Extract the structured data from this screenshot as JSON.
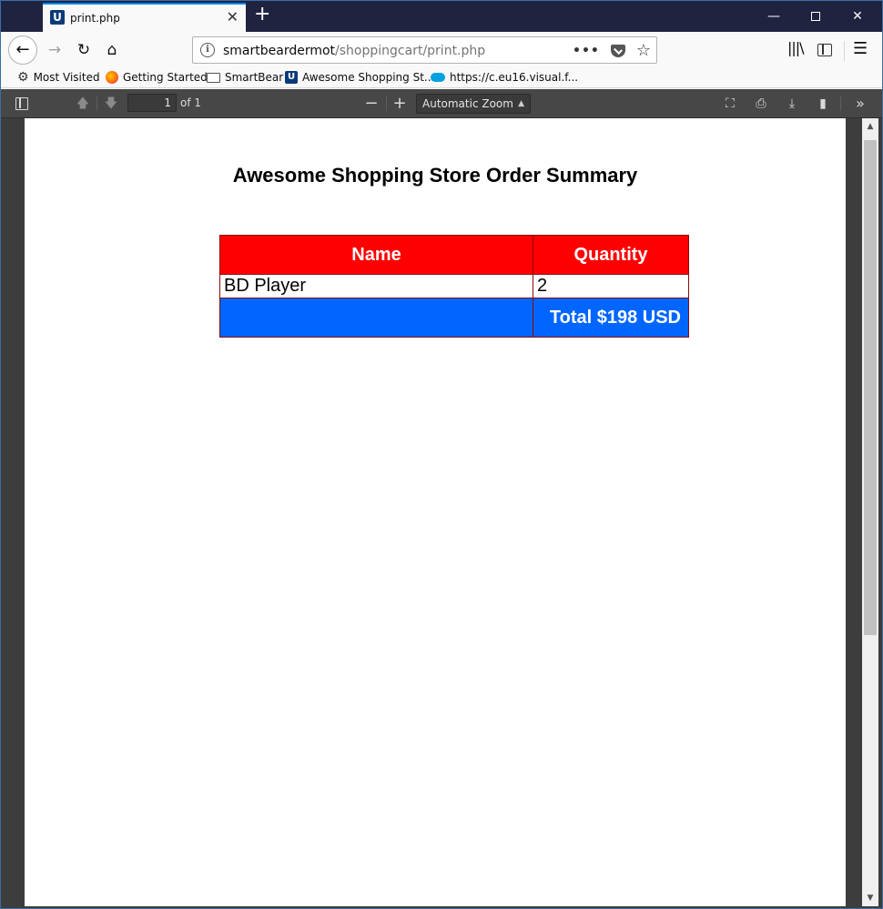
{
  "browser": {
    "tab_title": "print.php",
    "tab_favicon_letter": "U",
    "url_domain": "smartbeardermot",
    "url_path": "/shoppingcart/print.php"
  },
  "bookmarks": [
    {
      "label": "Most Visited",
      "icon": "gear-icon"
    },
    {
      "label": "Getting Started",
      "icon": "firefox-icon"
    },
    {
      "label": "SmartBear",
      "icon": "folder-icon"
    },
    {
      "label": "Awesome Shopping St...",
      "icon": "u-favicon-icon"
    },
    {
      "label": "https://c.eu16.visual.f...",
      "icon": "salesforce-cloud-icon"
    }
  ],
  "pdf_toolbar": {
    "page_number": "1",
    "page_count_label": "of 1",
    "zoom_label": "Automatic Zoom"
  },
  "document": {
    "title": "Awesome Shopping Store Order Summary",
    "table": {
      "headers": [
        "Name",
        "Quantity"
      ],
      "rows": [
        {
          "name": "BD Player",
          "quantity": "2"
        }
      ],
      "total_label": "Total $198 USD"
    }
  },
  "colors": {
    "header_red": "#ff0000",
    "total_blue": "#0066ff",
    "table_border": "#8b0a0a"
  }
}
